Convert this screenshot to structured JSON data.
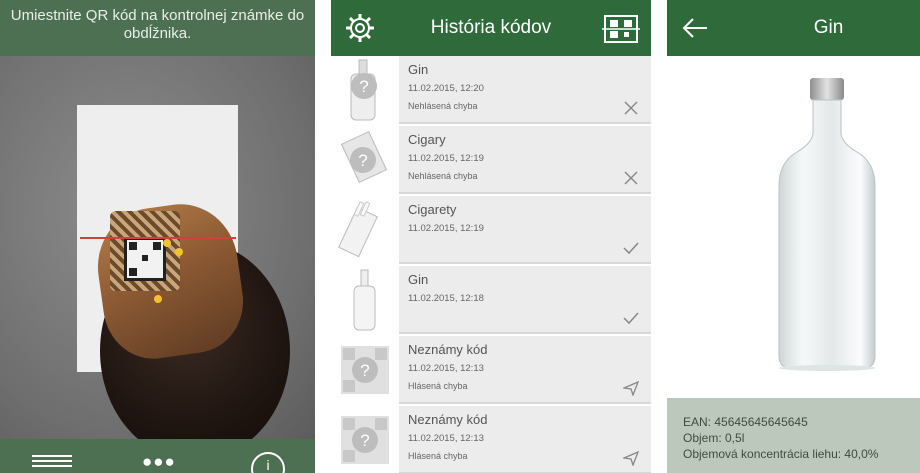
{
  "scanner": {
    "instruction": "Umiestnite QR kód na kontrolnej známke do obdĺžnika.",
    "toolbar": {
      "history_icon": "list-icon",
      "apps_icon": "grid-dots-icon",
      "info_icon": "info-icon"
    }
  },
  "history": {
    "title": "História kódov",
    "settings_icon": "gear-icon",
    "scan_icon": "qr-scan-icon",
    "items": [
      {
        "name": "Gin",
        "date": "11.02.2015, 12:20",
        "status": "Nehlásená chyba",
        "action": "close-icon",
        "thumb": "unknown-bottle"
      },
      {
        "name": "Cigary",
        "date": "11.02.2015, 12:19",
        "status": "Nehlásená chyba",
        "action": "close-icon",
        "thumb": "unknown-cigars"
      },
      {
        "name": "Cigarety",
        "date": "11.02.2015, 12:19",
        "status": "",
        "action": "check-icon",
        "thumb": "cigarettes"
      },
      {
        "name": "Gin",
        "date": "11.02.2015, 12:18",
        "status": "",
        "action": "check-icon",
        "thumb": "bottle"
      },
      {
        "name": "Neznámy kód",
        "date": "11.02.2015, 12:13",
        "status": "Hlásená chyba",
        "action": "send-icon",
        "thumb": "unknown-qr"
      },
      {
        "name": "Neznámy kód",
        "date": "11.02.2015, 12:13",
        "status": "Hlásená chyba",
        "action": "send-icon",
        "thumb": "unknown-qr"
      }
    ]
  },
  "detail": {
    "title": "Gin",
    "back_icon": "arrow-left-icon",
    "ean": "EAN: 45645645645645",
    "volume": "Objem: 0,5l",
    "alcohol": "Objemová koncentrácia liehu: 40,0%"
  },
  "colors": {
    "header_green": "#2f6b3a",
    "scanner_green": "#4d6f52",
    "info_bg": "#bcc8bc"
  }
}
